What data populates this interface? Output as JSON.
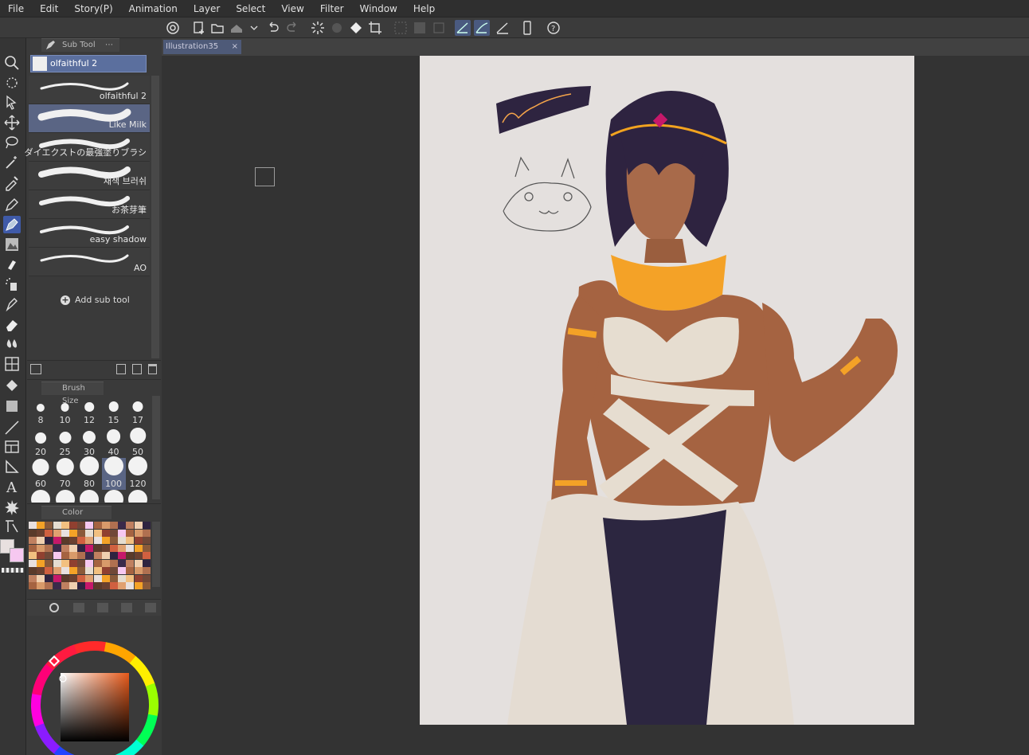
{
  "menu": [
    "File",
    "Edit",
    "Story(P)",
    "Animation",
    "Layer",
    "Select",
    "View",
    "Filter",
    "Window",
    "Help"
  ],
  "subtool": {
    "tab_label": "Sub Tool",
    "selected_group": "olfaithful 2",
    "brushes": [
      {
        "name": "olfaithful 2",
        "active": false
      },
      {
        "name": "Like Milk",
        "active": true
      },
      {
        "name": "ダイエクストの最強塗りブラシ",
        "active": false
      },
      {
        "name": "채색 브러쉬",
        "active": false
      },
      {
        "name": "お茶芽筆",
        "active": false
      },
      {
        "name": "easy shadow",
        "active": false
      },
      {
        "name": "AO",
        "active": false
      }
    ],
    "add_label": "Add sub tool"
  },
  "brush_size": {
    "tab_label": "Brush Size",
    "sizes": [
      "8",
      "10",
      "12",
      "15",
      "17",
      "20",
      "25",
      "30",
      "40",
      "50",
      "60",
      "70",
      "80",
      "100",
      "120"
    ],
    "active": "100"
  },
  "color_history": {
    "tab_label": "Color History"
  },
  "document": {
    "tab_label": "Illustration35",
    "close": "×"
  },
  "colors": {
    "accent": "#5a6584",
    "paper": "#e4e0de",
    "canvas_bg": "#333333"
  }
}
